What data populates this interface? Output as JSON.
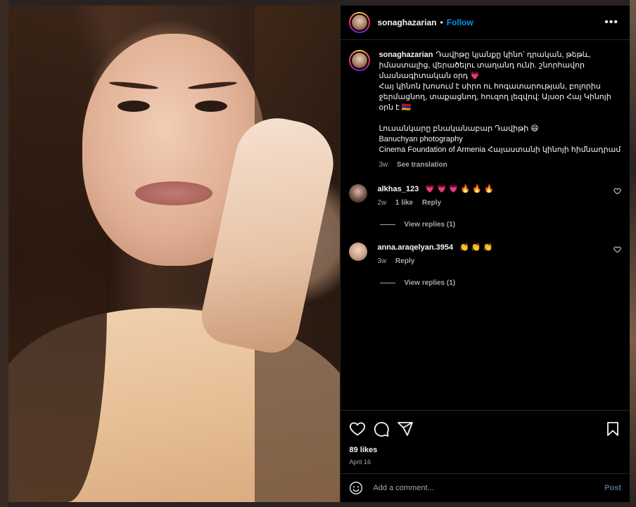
{
  "post": {
    "username": "sonaghazarian",
    "follow_label": "Follow",
    "more_label": "•••",
    "caption_lines": [
      "Դավիթը կյանքը կինո՝ դրական, թեթև, իմաստալից, վերածելու տաղանդ ունի. շնորհավոր մասնագիտական օրդ 💗",
      "Հայ կինոն խոսում է սիրո ու հոգատարության, բոլորիս ջերմացնող, տաքացնող, հուզող լեզվով: Այսօր Հայ Կինոյի օրն է 🇦🇲",
      "",
      "Լուսանկարը բնականաբար Դավիթի 😄",
      "Banuchyan photography",
      "Cinema Foundation of Armenia Հայաստանի կինոյի հիմնադրամ"
    ],
    "caption_age": "3w",
    "see_translation": "See translation",
    "likes": "89 likes",
    "date": "April 16"
  },
  "comments": [
    {
      "username": "alkhas_123",
      "text": "💗 💗 💗 🔥 🔥 🔥",
      "age": "2w",
      "likes": "1 like",
      "reply": "Reply",
      "view_replies": "View replies (1)"
    },
    {
      "username": "anna.araqelyan.3954",
      "text": "👏 👏 👏",
      "age": "3w",
      "reply": "Reply",
      "view_replies": "View replies (1)"
    }
  ],
  "add_comment": {
    "placeholder": "Add a comment...",
    "post_label": "Post"
  },
  "colors": {
    "accent": "#0095f6",
    "background": "#000000",
    "muted": "#a8a8a8"
  },
  "icons": [
    "more-icon",
    "heart-icon",
    "comment-icon",
    "share-icon",
    "bookmark-icon",
    "emoji-icon",
    "comment-like-icon"
  ]
}
